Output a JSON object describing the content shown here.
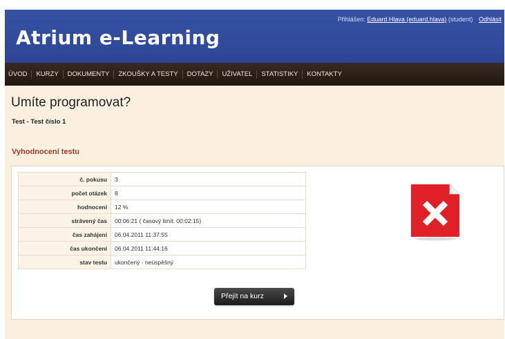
{
  "header": {
    "logo": "Atrium e-Learning",
    "logged_in_label": "Přihlášen:",
    "user_link": "Eduard Hlava (eduard.hlava)",
    "role": "(student)",
    "logout": "Odhlásit"
  },
  "nav": {
    "items": [
      "ÚVOD",
      "KURZY",
      "DOKUMENTY",
      "ZKOUŠKY A TESTY",
      "DOTAZY",
      "UŽIVATEL",
      "STATISTIKY",
      "KONTAKTY"
    ]
  },
  "main": {
    "title": "Umíte programovat?",
    "subtitle": "Test - Test číslo 1",
    "section_heading": "Vyhodnocení testu"
  },
  "results": [
    {
      "label": "č. pokusu",
      "value": "3"
    },
    {
      "label": "počet otázek",
      "value": "8"
    },
    {
      "label": "hodnocení",
      "value": "12 %"
    },
    {
      "label": "strávený čas",
      "value": "00:06:21 ( časový limit: 00:02:15)"
    },
    {
      "label": "čas zahájení",
      "value": "06.04.2011 11:37:55"
    },
    {
      "label": "čas ukončení",
      "value": "06.04.2011 11:44:16"
    },
    {
      "label": "stav testu",
      "value": "ukončený - neúspěšný"
    }
  ],
  "status_icon": {
    "name": "fail-document-icon",
    "color": "#e01f26"
  },
  "button": {
    "label": "Přejít na kurz"
  },
  "colors": {
    "header": "#3652a6",
    "nav": "#2a1d16",
    "page": "#fbf0e0",
    "accent": "#a33a2c"
  }
}
